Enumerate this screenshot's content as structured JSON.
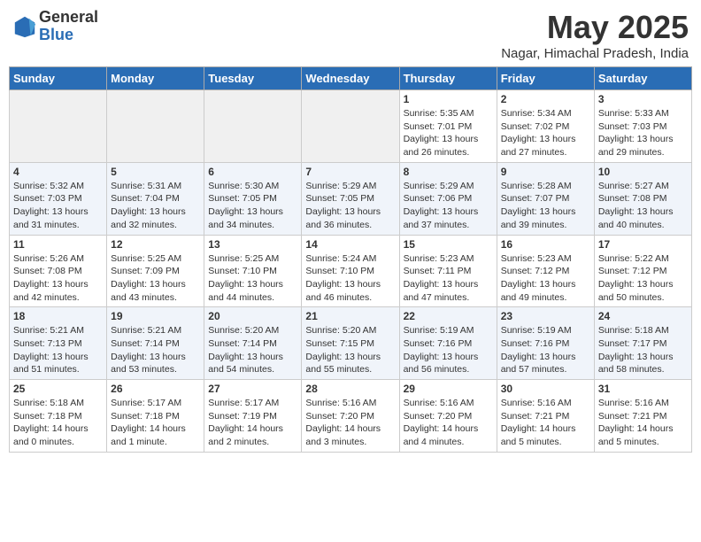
{
  "logo": {
    "general": "General",
    "blue": "Blue"
  },
  "title": "May 2025",
  "location": "Nagar, Himachal Pradesh, India",
  "weekdays": [
    "Sunday",
    "Monday",
    "Tuesday",
    "Wednesday",
    "Thursday",
    "Friday",
    "Saturday"
  ],
  "weeks": [
    [
      {
        "day": "",
        "info": ""
      },
      {
        "day": "",
        "info": ""
      },
      {
        "day": "",
        "info": ""
      },
      {
        "day": "",
        "info": ""
      },
      {
        "day": "1",
        "info": "Sunrise: 5:35 AM\nSunset: 7:01 PM\nDaylight: 13 hours\nand 26 minutes."
      },
      {
        "day": "2",
        "info": "Sunrise: 5:34 AM\nSunset: 7:02 PM\nDaylight: 13 hours\nand 27 minutes."
      },
      {
        "day": "3",
        "info": "Sunrise: 5:33 AM\nSunset: 7:03 PM\nDaylight: 13 hours\nand 29 minutes."
      }
    ],
    [
      {
        "day": "4",
        "info": "Sunrise: 5:32 AM\nSunset: 7:03 PM\nDaylight: 13 hours\nand 31 minutes."
      },
      {
        "day": "5",
        "info": "Sunrise: 5:31 AM\nSunset: 7:04 PM\nDaylight: 13 hours\nand 32 minutes."
      },
      {
        "day": "6",
        "info": "Sunrise: 5:30 AM\nSunset: 7:05 PM\nDaylight: 13 hours\nand 34 minutes."
      },
      {
        "day": "7",
        "info": "Sunrise: 5:29 AM\nSunset: 7:05 PM\nDaylight: 13 hours\nand 36 minutes."
      },
      {
        "day": "8",
        "info": "Sunrise: 5:29 AM\nSunset: 7:06 PM\nDaylight: 13 hours\nand 37 minutes."
      },
      {
        "day": "9",
        "info": "Sunrise: 5:28 AM\nSunset: 7:07 PM\nDaylight: 13 hours\nand 39 minutes."
      },
      {
        "day": "10",
        "info": "Sunrise: 5:27 AM\nSunset: 7:08 PM\nDaylight: 13 hours\nand 40 minutes."
      }
    ],
    [
      {
        "day": "11",
        "info": "Sunrise: 5:26 AM\nSunset: 7:08 PM\nDaylight: 13 hours\nand 42 minutes."
      },
      {
        "day": "12",
        "info": "Sunrise: 5:25 AM\nSunset: 7:09 PM\nDaylight: 13 hours\nand 43 minutes."
      },
      {
        "day": "13",
        "info": "Sunrise: 5:25 AM\nSunset: 7:10 PM\nDaylight: 13 hours\nand 44 minutes."
      },
      {
        "day": "14",
        "info": "Sunrise: 5:24 AM\nSunset: 7:10 PM\nDaylight: 13 hours\nand 46 minutes."
      },
      {
        "day": "15",
        "info": "Sunrise: 5:23 AM\nSunset: 7:11 PM\nDaylight: 13 hours\nand 47 minutes."
      },
      {
        "day": "16",
        "info": "Sunrise: 5:23 AM\nSunset: 7:12 PM\nDaylight: 13 hours\nand 49 minutes."
      },
      {
        "day": "17",
        "info": "Sunrise: 5:22 AM\nSunset: 7:12 PM\nDaylight: 13 hours\nand 50 minutes."
      }
    ],
    [
      {
        "day": "18",
        "info": "Sunrise: 5:21 AM\nSunset: 7:13 PM\nDaylight: 13 hours\nand 51 minutes."
      },
      {
        "day": "19",
        "info": "Sunrise: 5:21 AM\nSunset: 7:14 PM\nDaylight: 13 hours\nand 53 minutes."
      },
      {
        "day": "20",
        "info": "Sunrise: 5:20 AM\nSunset: 7:14 PM\nDaylight: 13 hours\nand 54 minutes."
      },
      {
        "day": "21",
        "info": "Sunrise: 5:20 AM\nSunset: 7:15 PM\nDaylight: 13 hours\nand 55 minutes."
      },
      {
        "day": "22",
        "info": "Sunrise: 5:19 AM\nSunset: 7:16 PM\nDaylight: 13 hours\nand 56 minutes."
      },
      {
        "day": "23",
        "info": "Sunrise: 5:19 AM\nSunset: 7:16 PM\nDaylight: 13 hours\nand 57 minutes."
      },
      {
        "day": "24",
        "info": "Sunrise: 5:18 AM\nSunset: 7:17 PM\nDaylight: 13 hours\nand 58 minutes."
      }
    ],
    [
      {
        "day": "25",
        "info": "Sunrise: 5:18 AM\nSunset: 7:18 PM\nDaylight: 14 hours\nand 0 minutes."
      },
      {
        "day": "26",
        "info": "Sunrise: 5:17 AM\nSunset: 7:18 PM\nDaylight: 14 hours\nand 1 minute."
      },
      {
        "day": "27",
        "info": "Sunrise: 5:17 AM\nSunset: 7:19 PM\nDaylight: 14 hours\nand 2 minutes."
      },
      {
        "day": "28",
        "info": "Sunrise: 5:16 AM\nSunset: 7:20 PM\nDaylight: 14 hours\nand 3 minutes."
      },
      {
        "day": "29",
        "info": "Sunrise: 5:16 AM\nSunset: 7:20 PM\nDaylight: 14 hours\nand 4 minutes."
      },
      {
        "day": "30",
        "info": "Sunrise: 5:16 AM\nSunset: 7:21 PM\nDaylight: 14 hours\nand 5 minutes."
      },
      {
        "day": "31",
        "info": "Sunrise: 5:16 AM\nSunset: 7:21 PM\nDaylight: 14 hours\nand 5 minutes."
      }
    ]
  ]
}
